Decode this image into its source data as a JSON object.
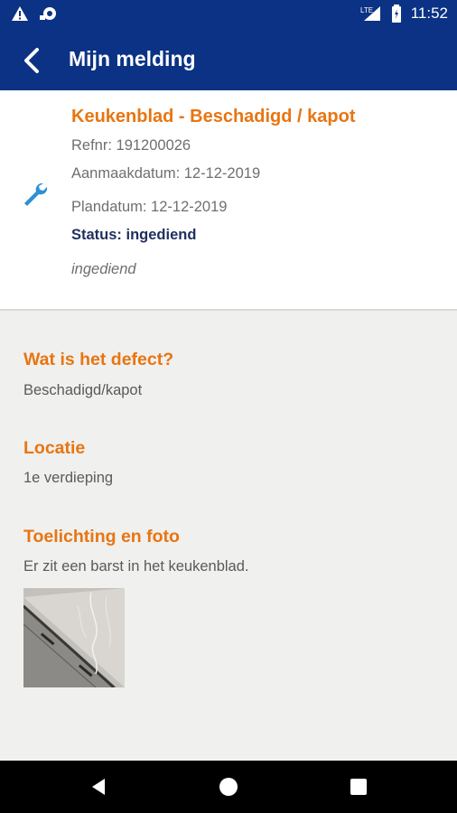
{
  "status_bar": {
    "time": "11:52",
    "network": "LTE",
    "icons": [
      "warning-icon",
      "cast-icon",
      "signal-icon",
      "battery-icon"
    ]
  },
  "app_bar": {
    "title": "Mijn melding",
    "back_icon": "chevron-left-icon"
  },
  "report": {
    "icon": "wrench-icon",
    "title": "Keukenblad - Beschadigd / kapot",
    "refnr": "Refnr: 191200026",
    "created": "Aanmaakdatum:  12-12-2019",
    "planned": "Plandatum: 12-12-2019",
    "status_label": "Status:  ingediend",
    "status_note": "ingediend"
  },
  "details": {
    "defect_heading": "Wat is het defect?",
    "defect_value": "Beschadigd/kapot",
    "location_heading": "Locatie",
    "location_value": "1e verdieping",
    "explanation_heading": "Toelichting en foto",
    "explanation_value": "Er zit een barst in het keukenblad."
  },
  "colors": {
    "primary": "#0b3285",
    "accent": "#e87511",
    "icon_blue": "#2e8fd6",
    "background": "#f0f0ef"
  },
  "nav_bar": {
    "buttons": [
      "back-triangle-icon",
      "home-circle-icon",
      "recents-square-icon"
    ]
  }
}
